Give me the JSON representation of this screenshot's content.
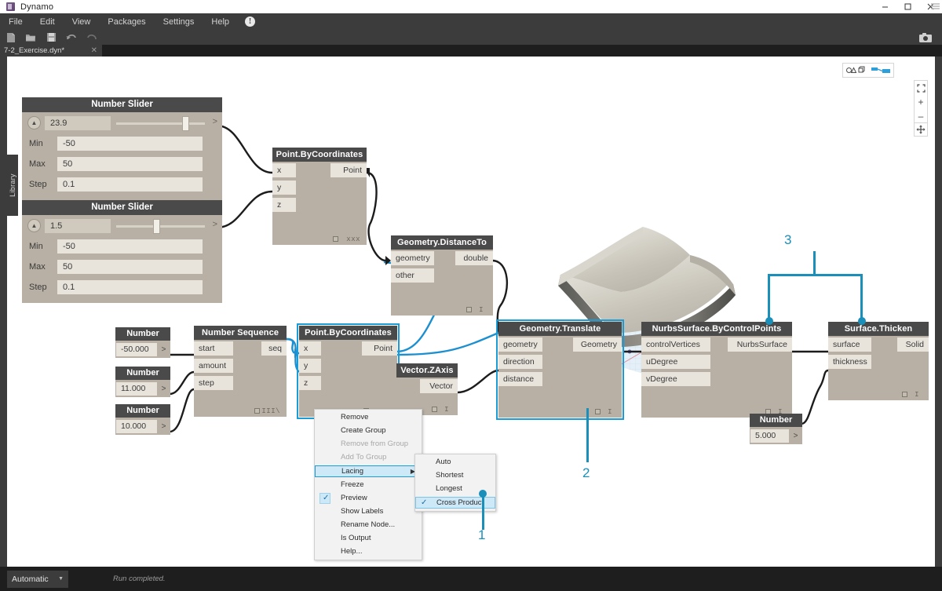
{
  "window": {
    "title": "Dynamo",
    "logo_icon": "dynamo-logo-icon",
    "minimize_icon": "minimize-icon",
    "maximize_icon": "maximize-icon",
    "close_icon": "close-icon"
  },
  "menubar": {
    "items": [
      "File",
      "Edit",
      "View",
      "Packages",
      "Settings",
      "Help"
    ],
    "info_icon": "info-icon",
    "info_label": "!"
  },
  "toolbar": {
    "icons": [
      "new-file-icon",
      "open-folder-icon",
      "save-icon",
      "undo-icon",
      "redo-icon"
    ],
    "camera_icon": "screenshot-camera-icon"
  },
  "tabstrip": {
    "file_tab_label": "7-2_Exercise.dyn*",
    "close_icon": "close-icon"
  },
  "library": {
    "label": "Library"
  },
  "viewport_controls": {
    "geometry_toggle_icon": "geometry-view-icon",
    "graph_toggle_icon": "graph-view-icon",
    "fit_icon": "zoom-to-fit-icon",
    "zoom_in_label": "+",
    "zoom_out_label": "–",
    "pan_icon": "pan-icon",
    "menu_icon": "hamburger-menu-icon"
  },
  "statusbar": {
    "run_mode": "Automatic",
    "run_caret_icon": "chevron-down-icon",
    "message": "Run completed."
  },
  "sliders": [
    {
      "title": "Number Slider",
      "value": "23.9",
      "min_label": "Min",
      "min": "-50",
      "max_label": "Max",
      "max": "50",
      "step_label": "Step",
      "step": "0.1",
      "thumb_pct": 74,
      "caret_icon": "chevron-up-icon",
      "expand_icon": "chevron-right-icon"
    },
    {
      "title": "Number Slider",
      "value": "1.5",
      "min_label": "Min",
      "min": "-50",
      "max_label": "Max",
      "max": "50",
      "step_label": "Step",
      "step": "0.1",
      "thumb_pct": 51,
      "caret_icon": "chevron-up-icon",
      "expand_icon": "chevron-right-icon"
    }
  ],
  "number_nodes": [
    {
      "title": "Number",
      "value": "-50.000",
      "caret_icon": "chevron-right-icon"
    },
    {
      "title": "Number",
      "value": "11.000",
      "caret_icon": "chevron-right-icon"
    },
    {
      "title": "Number",
      "value": "10.000",
      "caret_icon": "chevron-right-icon"
    },
    {
      "title": "Number",
      "value": "5.000",
      "caret_icon": "chevron-right-icon"
    }
  ],
  "nodes": [
    {
      "title": "Point.ByCoordinates",
      "inputs": [
        "x",
        "y",
        "z"
      ],
      "outputs": [
        "Point"
      ],
      "footer_dots": "xxx",
      "selected": false
    },
    {
      "title": "Geometry.DistanceTo",
      "inputs": [
        "geometry",
        "other"
      ],
      "outputs": [
        "double"
      ],
      "footer_dots": "I",
      "selected": false
    },
    {
      "title": "Number Sequence",
      "inputs": [
        "start",
        "amount",
        "step"
      ],
      "outputs": [
        "seq"
      ],
      "footer_dots": "III\\",
      "selected": false
    },
    {
      "title": "Point.ByCoordinates",
      "inputs": [
        "x",
        "y",
        "z"
      ],
      "outputs": [
        "Point"
      ],
      "footer_dots": "xxx",
      "selected": true
    },
    {
      "title": "Vector.ZAxis",
      "inputs": [],
      "outputs": [
        "Vector"
      ],
      "footer_dots": "I",
      "selected": false
    },
    {
      "title": "Geometry.Translate",
      "inputs": [
        "geometry",
        "direction",
        "distance"
      ],
      "outputs": [
        "Geometry"
      ],
      "footer_dots": "I",
      "selected": true
    },
    {
      "title": "NurbsSurface.ByControlPoints",
      "inputs": [
        "controlVertices",
        "uDegree",
        "vDegree"
      ],
      "outputs": [
        "NurbsSurface"
      ],
      "footer_dots": "I",
      "selected": false
    },
    {
      "title": "Surface.Thicken",
      "inputs": [
        "surface",
        "thickness"
      ],
      "outputs": [
        "Solid"
      ],
      "footer_dots": "I",
      "selected": false
    }
  ],
  "context_menu": {
    "items": [
      {
        "label": "Remove",
        "state": "normal"
      },
      {
        "label": "Create Group",
        "state": "normal"
      },
      {
        "label": "Remove from Group",
        "state": "disabled"
      },
      {
        "label": "Add To Group",
        "state": "disabled"
      },
      {
        "label": "Lacing",
        "state": "highlight",
        "submenu_arrow": "▶"
      },
      {
        "label": "Freeze",
        "state": "normal"
      },
      {
        "label": "Preview",
        "state": "checked"
      },
      {
        "label": "Show Labels",
        "state": "normal"
      },
      {
        "label": "Rename Node...",
        "state": "normal"
      },
      {
        "label": "Is Output",
        "state": "normal"
      },
      {
        "label": "Help...",
        "state": "normal"
      }
    ],
    "submenu": {
      "items": [
        {
          "label": "Auto",
          "state": "normal"
        },
        {
          "label": "Shortest",
          "state": "normal"
        },
        {
          "label": "Longest",
          "state": "normal"
        },
        {
          "label": "Cross Product",
          "state": "checked-selected"
        }
      ]
    },
    "check_glyph": "✓"
  },
  "annotations": [
    {
      "label": "1"
    },
    {
      "label": "2"
    },
    {
      "label": "3"
    }
  ],
  "colors": {
    "accent": "#1a8fb9",
    "selection": "#1c9cd6",
    "node_header": "#4a4a4a",
    "node_body": "#b8b0a4",
    "port": "#e8e4dc",
    "chrome": "#3c3c3c",
    "statusbar": "#1e1e1e"
  }
}
